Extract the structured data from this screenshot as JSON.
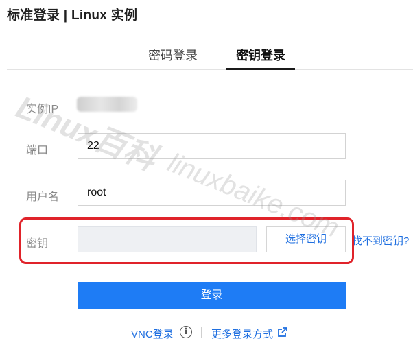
{
  "header": {
    "title": "标准登录 | Linux 实例"
  },
  "tabs": [
    {
      "label": "密码登录",
      "active": false
    },
    {
      "label": "密钥登录",
      "active": true
    }
  ],
  "form": {
    "ip_label": "实例IP",
    "port_label": "端口",
    "port_value": "22",
    "username_label": "用户名",
    "username_value": "root",
    "key_label": "密钥",
    "choose_key_label": "选择密钥",
    "not_found_label": "找不到密钥?",
    "login_label": "登录"
  },
  "footer": {
    "vnc_label": "VNC登录",
    "more_label": "更多登录方式"
  },
  "watermark": {
    "line1": "Linux百科",
    "line2": "linuxbaike.com"
  },
  "colors": {
    "accent": "#1e7cf5",
    "link": "#1f6fe0",
    "highlight": "#e0232a"
  },
  "icons": {
    "info": "info-icon",
    "external_link": "external-link-icon"
  }
}
